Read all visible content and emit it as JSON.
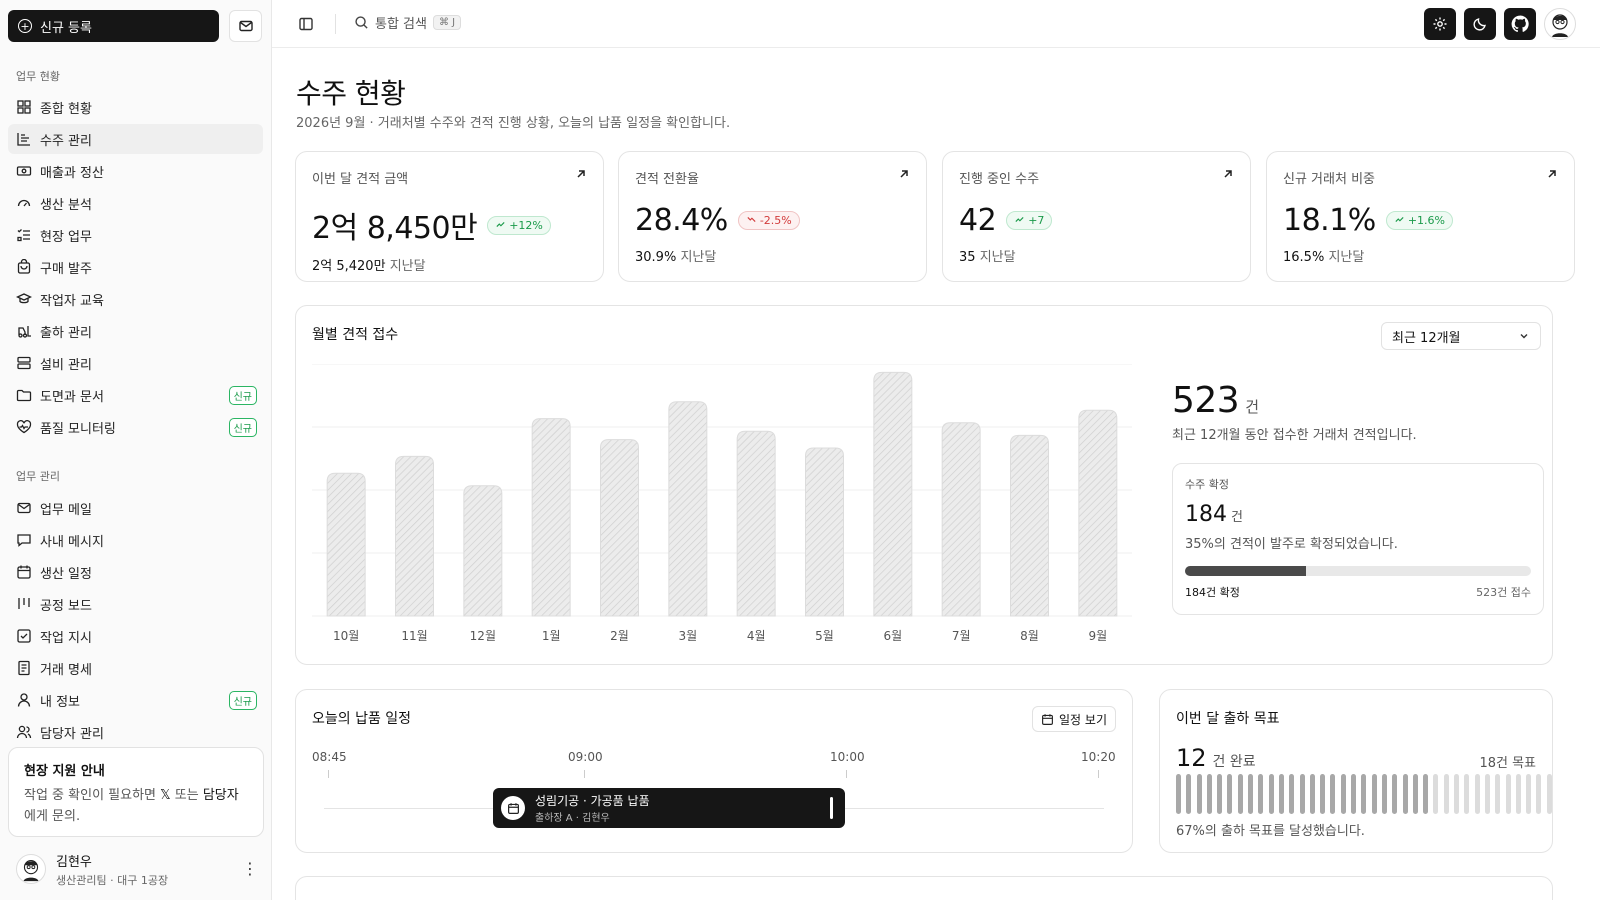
{
  "sidebar": {
    "new_button": "신규 등록",
    "section1": "업무 현황",
    "section2": "업무 관리",
    "items1": [
      {
        "label": "종합 현황",
        "icon": "dashboard-icon"
      },
      {
        "label": "수주 관리",
        "icon": "chart-icon",
        "active": true
      },
      {
        "label": "매출과 정산",
        "icon": "money-icon"
      },
      {
        "label": "생산 분석",
        "icon": "gauge-icon"
      },
      {
        "label": "현장 업무",
        "icon": "list-check-icon"
      },
      {
        "label": "구매 발주",
        "icon": "bag-icon"
      },
      {
        "label": "작업자 교육",
        "icon": "graduation-icon"
      },
      {
        "label": "출하 관리",
        "icon": "forklift-icon"
      },
      {
        "label": "설비 관리",
        "icon": "server-icon"
      },
      {
        "label": "도면과 문서",
        "icon": "folder-icon",
        "badge": "신규"
      },
      {
        "label": "품질 모니터링",
        "icon": "heart-pulse-icon",
        "badge": "신규"
      }
    ],
    "items2": [
      {
        "label": "업무 메일",
        "icon": "mail-icon"
      },
      {
        "label": "사내 메시지",
        "icon": "message-icon"
      },
      {
        "label": "생산 일정",
        "icon": "calendar-icon"
      },
      {
        "label": "공정 보드",
        "icon": "kanban-icon"
      },
      {
        "label": "작업 지시",
        "icon": "checkbox-icon"
      },
      {
        "label": "거래 명세",
        "icon": "document-icon"
      },
      {
        "label": "내 정보",
        "icon": "user-icon",
        "badge": "신규"
      },
      {
        "label": "담당자 관리",
        "icon": "users-icon"
      }
    ],
    "support": {
      "title": "현장 지원 안내",
      "text_before": "작업 중 확인이 필요하면 ",
      "x_symbol": "𝕏",
      "text_middle": " 또는 ",
      "contact": "담당자",
      "text_after": "에게 문의."
    },
    "user": {
      "name": "김현우",
      "team": "생산관리팀 · 대구 1공장"
    }
  },
  "topbar": {
    "search_label": "통합 검색",
    "shortcut": "⌘ J",
    "icons": [
      "settings-icon",
      "moon-icon",
      "github-icon"
    ]
  },
  "page": {
    "title": "수주 현황",
    "subtitle": "2026년 9월 · 거래처별 수주와 견적 진행 상황, 오늘의 납품 일정을 확인합니다."
  },
  "stats": [
    {
      "label": "이번 달 견적 금액",
      "value": "2억 8,450만",
      "change": "+12%",
      "trend": "up",
      "prev_value": "2억 5,420만",
      "prev_label": "지난달"
    },
    {
      "label": "견적 전환율",
      "value": "28.4%",
      "change": "-2.5%",
      "trend": "down",
      "prev_value": "30.9%",
      "prev_label": "지난달"
    },
    {
      "label": "진행 중인 수주",
      "value": "42",
      "change": "+7",
      "trend": "up",
      "prev_value": "35",
      "prev_label": "지난달"
    },
    {
      "label": "신규 거래처 비중",
      "value": "18.1%",
      "change": "+1.6%",
      "trend": "up",
      "prev_value": "16.5%",
      "prev_label": "지난달"
    }
  ],
  "monthly": {
    "title": "월별 견적 접수",
    "range_select": "최근 12개월",
    "total": "523",
    "total_unit": "건",
    "total_desc": "최근 12개월 동안 접수한 거래처 견적입니다.",
    "confirmed": {
      "label": "수주 확정",
      "value": "184",
      "unit": "건",
      "desc": "35%의 견적이 발주로 확정되었습니다.",
      "progress": 0.35,
      "left": "184건 확정",
      "right": "523건 접수"
    }
  },
  "chart_data": {
    "type": "bar",
    "categories": [
      "10월",
      "11월",
      "12월",
      "1월",
      "2월",
      "3월",
      "4월",
      "5월",
      "6월",
      "7월",
      "8월",
      "9월"
    ],
    "values": [
      34,
      38,
      31,
      47,
      42,
      51,
      44,
      40,
      58,
      46,
      43,
      49
    ],
    "ylim": [
      0,
      60
    ],
    "grid": true,
    "title": "월별 견적 접수"
  },
  "schedule": {
    "title": "오늘의 납품 일정",
    "button": "일정 보기",
    "times": [
      "08:45",
      "09:00",
      "10:00",
      "10:20"
    ],
    "event": {
      "title": "성림기공 · 가공품 납품",
      "sub": "출하장 A · 김현우"
    }
  },
  "goal": {
    "title": "이번 달 출하 목표",
    "done": "12",
    "done_unit": "건 완료",
    "target": "18건 목표",
    "desc": "67%의 출하 목표를 달성했습니다.",
    "progress": 0.67,
    "bar_count": 37,
    "bar_dark": "#a8a8a8",
    "bar_light": "#dcdcdc"
  }
}
